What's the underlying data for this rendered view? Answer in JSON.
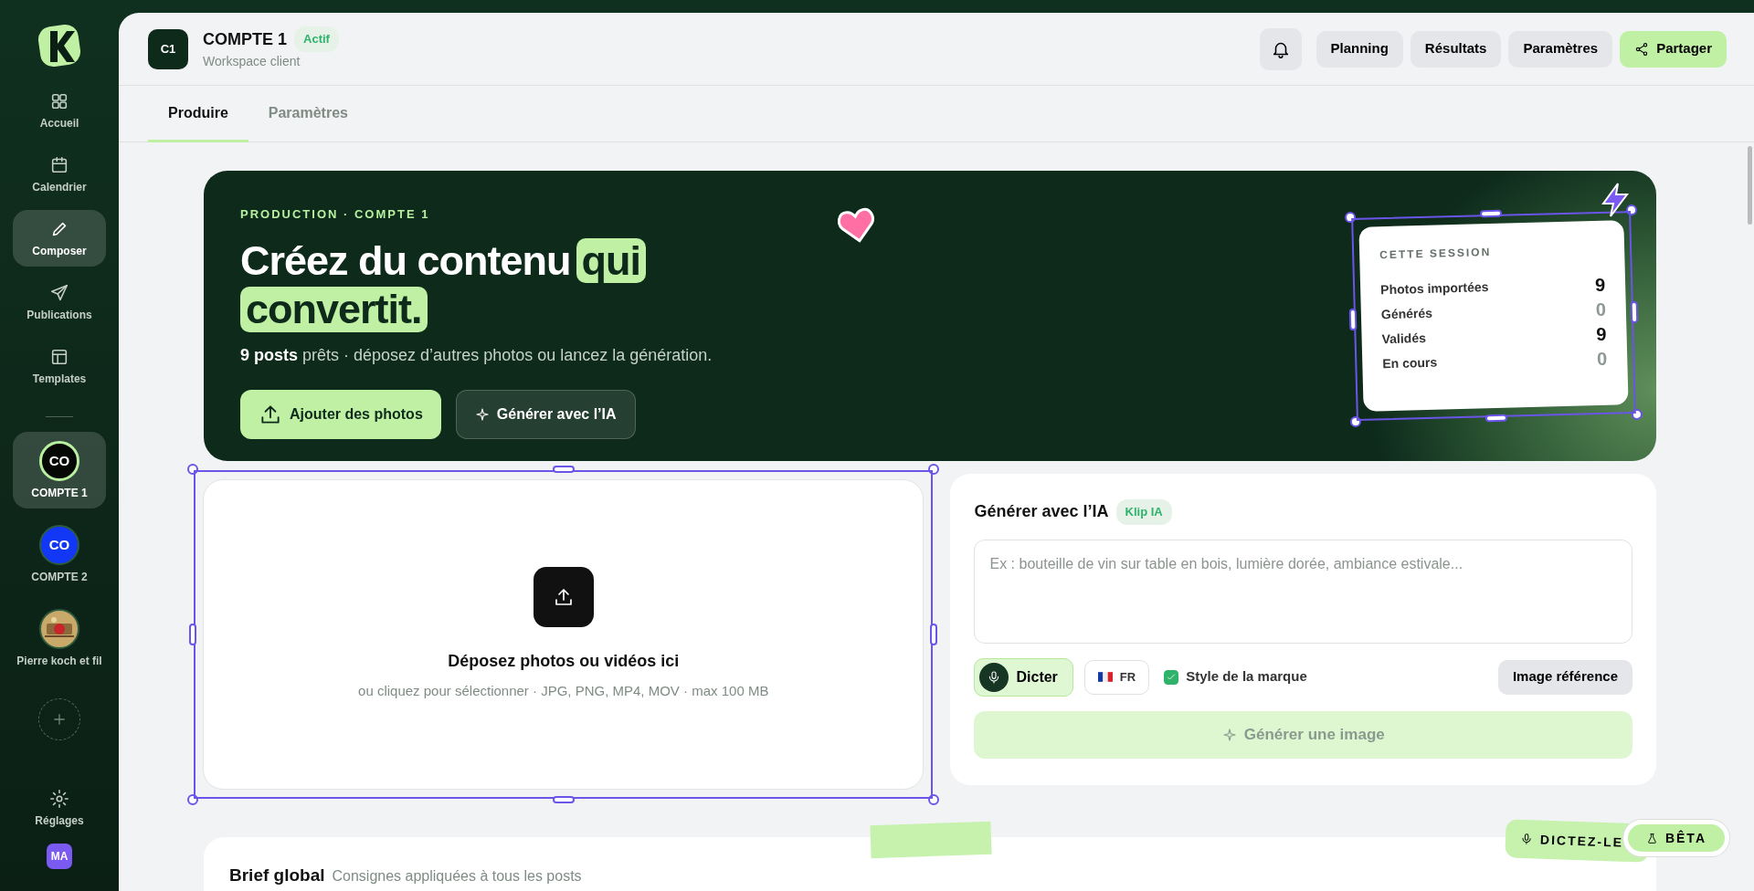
{
  "sidebar": {
    "nav": [
      {
        "label": "Accueil",
        "selected": false
      },
      {
        "label": "Calendrier",
        "selected": false
      },
      {
        "label": "Composer",
        "selected": true
      },
      {
        "label": "Publications",
        "selected": false
      },
      {
        "label": "Templates",
        "selected": false
      }
    ],
    "accounts": [
      {
        "kind": "initials",
        "initials": "CO",
        "label": "COMPTE 1",
        "color": "#050805",
        "selected": true
      },
      {
        "kind": "initials",
        "initials": "CO",
        "label": "COMPTE 2",
        "color": "#1238f5",
        "selected": false
      },
      {
        "kind": "picture",
        "label": "Pierre koch et fil",
        "selected": false
      }
    ],
    "settings": "Réglages",
    "user": "MA"
  },
  "header": {
    "badge": "C1",
    "title": "COMPTE 1",
    "status": "Actif",
    "subtitle": "Workspace client",
    "buttons": [
      {
        "kind": "bell"
      },
      {
        "kind": "plain",
        "label": "Planning"
      },
      {
        "kind": "plain",
        "label": "Résultats"
      },
      {
        "kind": "plain",
        "label": "Paramètres"
      },
      {
        "kind": "primary",
        "label": "Partager"
      }
    ]
  },
  "tabs": [
    {
      "label": "Produire",
      "selected": true
    },
    {
      "label": "Paramètres",
      "selected": false
    }
  ],
  "hero": {
    "eyebrow": "PRODUCTION · COMPTE 1",
    "title": [
      {
        "text": "Créez du contenu",
        "highlight": false
      },
      {
        "text": "qui",
        "highlight": true
      },
      {
        "text": "convertit.",
        "highlight": true
      }
    ],
    "subtitle": "**9 posts** prêts · déposez d’autres photos ou lancez la génération.",
    "buttons": [
      {
        "kind": "primary",
        "label": "Ajouter des photos"
      },
      {
        "kind": "ghost",
        "label": "Générer avec l’IA"
      }
    ]
  },
  "session": {
    "title": "CETTE SESSION",
    "rows": [
      {
        "label": "Photos importées",
        "value": "9",
        "muted": false
      },
      {
        "label": "Générés",
        "value": "0",
        "muted": true
      },
      {
        "label": "Validés",
        "value": "9",
        "muted": false
      },
      {
        "label": "En cours",
        "value": "0",
        "muted": true
      }
    ]
  },
  "upload": {
    "title": "Déposez photos ou vidéos ici",
    "hint": "ou cliquez pour sélectionner · JPG, PNG, MP4, MOV · max 100 MB"
  },
  "ai": {
    "title": "Générer avec l’IA",
    "badge": "Klip IA",
    "placeholder": "Ex : bouteille de vin sur table en bois, lumière dorée, ambiance estivale...",
    "dictate": "Dicter",
    "language": "FR",
    "brand_style": {
      "label": "Style de la marque",
      "checked": true
    },
    "reference": "Image référence",
    "generate": {
      "label": "Générer une image",
      "disabled": true
    }
  },
  "brief": {
    "title": "Brief global",
    "subtitle": "Consignes appliquées à tous les posts"
  },
  "floating": {
    "dictate": "DICTEZ-LE",
    "beta": "BÊTA"
  }
}
